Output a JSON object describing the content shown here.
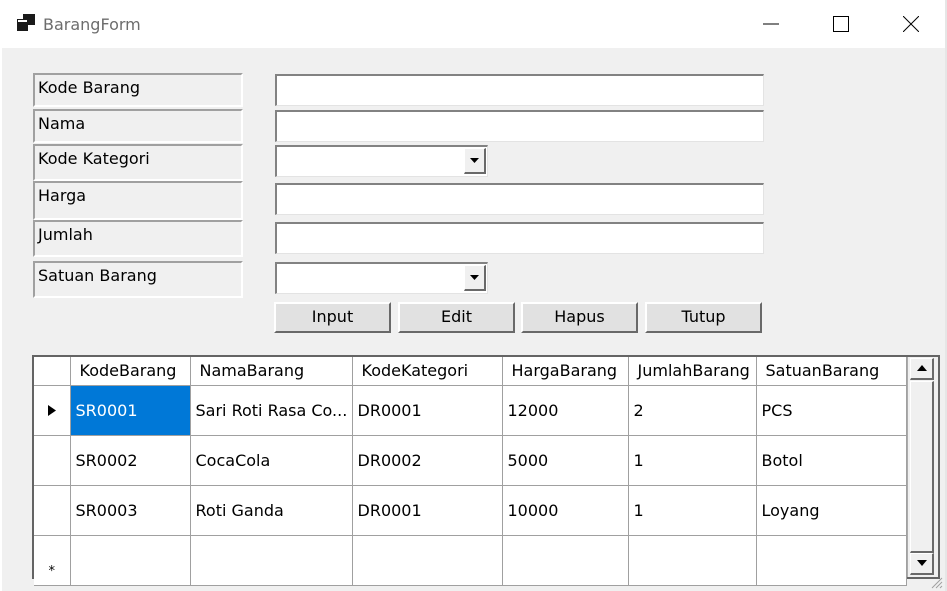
{
  "window": {
    "title": "BarangForm",
    "icon": "app-window-icon"
  },
  "form": {
    "fields": [
      {
        "label": "Kode Barang",
        "value": ""
      },
      {
        "label": "Nama",
        "value": ""
      },
      {
        "label": "Kode Kategori",
        "value": ""
      },
      {
        "label": "Harga",
        "value": ""
      },
      {
        "label": "Jumlah",
        "value": ""
      },
      {
        "label": "Satuan Barang",
        "value": ""
      }
    ],
    "buttons": {
      "input": "Input",
      "edit": "Edit",
      "hapus": "Hapus",
      "tutup": "Tutup"
    }
  },
  "grid": {
    "columns": [
      "KodeBarang",
      "NamaBarang",
      "KodeKategori",
      "HargaBarang",
      "JumlahBarang",
      "SatuanBarang"
    ],
    "rows": [
      [
        "SR0001",
        "Sari Roti Rasa Co...",
        "DR0001",
        "12000",
        "2",
        "PCS"
      ],
      [
        "SR0002",
        "CocaCola",
        "DR0002",
        "5000",
        "1",
        "Botol"
      ],
      [
        "SR0003",
        "Roti Ganda",
        "DR0001",
        "10000",
        "1",
        "Loyang"
      ]
    ],
    "current_row_marker": "▶",
    "new_row_marker": "*"
  },
  "colors": {
    "selection": "#0078d7",
    "form_background": "#f0f0f0"
  }
}
